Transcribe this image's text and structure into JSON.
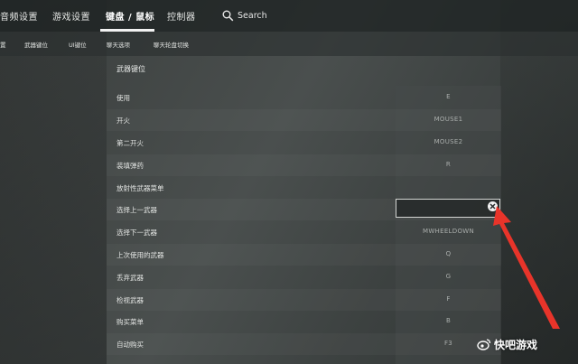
{
  "topnav": {
    "tabs": [
      {
        "label": "音频设置"
      },
      {
        "label": "游戏设置"
      },
      {
        "label": "键盘 / 鼠标",
        "active": true
      },
      {
        "label": "控制器"
      }
    ],
    "search_label": "Search"
  },
  "subnav": {
    "tabs": [
      {
        "label": "置"
      },
      {
        "label": "武器键位"
      },
      {
        "label": "UI键位"
      },
      {
        "label": "聊天选项"
      },
      {
        "label": "聊天轮盘切换"
      }
    ]
  },
  "section": {
    "title": "武器键位",
    "rows": [
      {
        "label": "使用",
        "value": "E"
      },
      {
        "label": "开火",
        "value": "MOUSE1"
      },
      {
        "label": "第二开火",
        "value": "MOUSE2"
      },
      {
        "label": "装填弹药",
        "value": "R"
      },
      {
        "label": "放射性武器菜单",
        "value": ""
      },
      {
        "label": "选择上一武器",
        "value": "",
        "editing": true
      },
      {
        "label": "选择下一武器",
        "value": "MWHEELDOWN"
      },
      {
        "label": "上次使用的武器",
        "value": "Q"
      },
      {
        "label": "丢弃武器",
        "value": "G"
      },
      {
        "label": "检视武器",
        "value": "F"
      },
      {
        "label": "购买菜单",
        "value": "B"
      },
      {
        "label": "自动购买",
        "value": "F3"
      }
    ]
  },
  "watermark": {
    "text": "快吧游戏"
  },
  "colors": {
    "arrow": "#e8342a",
    "bg": "#3f4443",
    "nav_bg": "#1e2222"
  },
  "icons": {
    "search": "search-icon",
    "clear": "close-icon",
    "watermark": "weibo-icon"
  }
}
